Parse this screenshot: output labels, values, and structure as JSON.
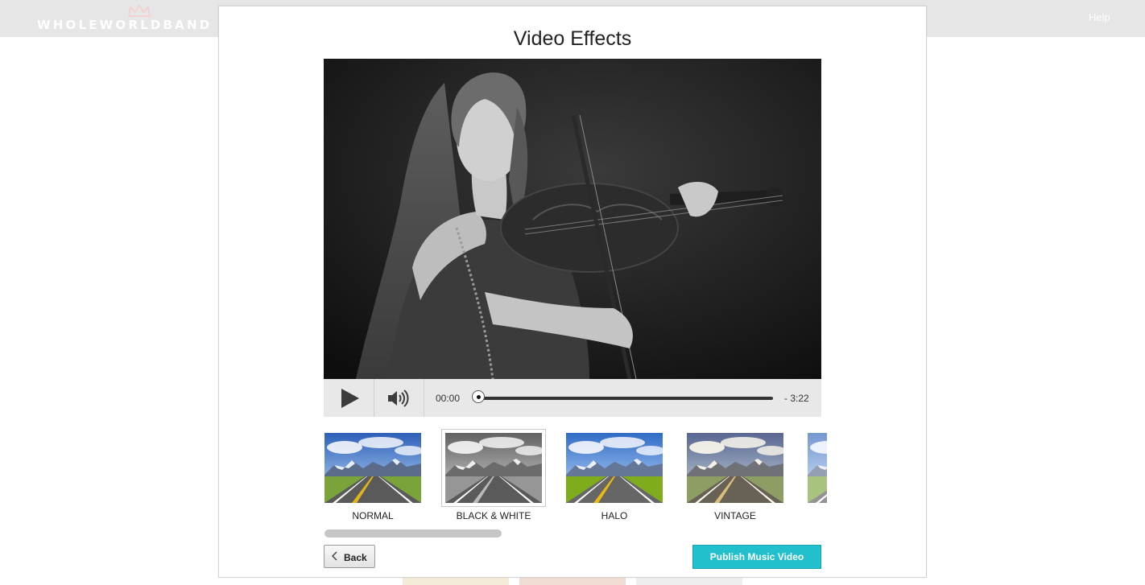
{
  "header": {
    "logo_text": "WHOLEWORLDBAND",
    "help_label": "Help",
    "background_color": "#e6e6e6"
  },
  "modal": {
    "title": "Video Effects"
  },
  "player": {
    "current_time": "00:00",
    "remaining_time": "- 3:22",
    "progress": 0,
    "play_icon": "play-icon",
    "volume_icon": "volume-icon"
  },
  "effects": {
    "items": [
      {
        "label": "NORMAL",
        "filter": "none",
        "selected": false
      },
      {
        "label": "BLACK & WHITE",
        "filter": "grayscale",
        "selected": true
      },
      {
        "label": "HALO",
        "filter": "halo",
        "selected": false
      },
      {
        "label": "VINTAGE",
        "filter": "vintage",
        "selected": false
      },
      {
        "label": "",
        "filter": "faded",
        "selected": false
      }
    ]
  },
  "actions": {
    "back_label": "Back",
    "publish_label": "Publish Music Video",
    "accent_color": "#22bfcc"
  }
}
